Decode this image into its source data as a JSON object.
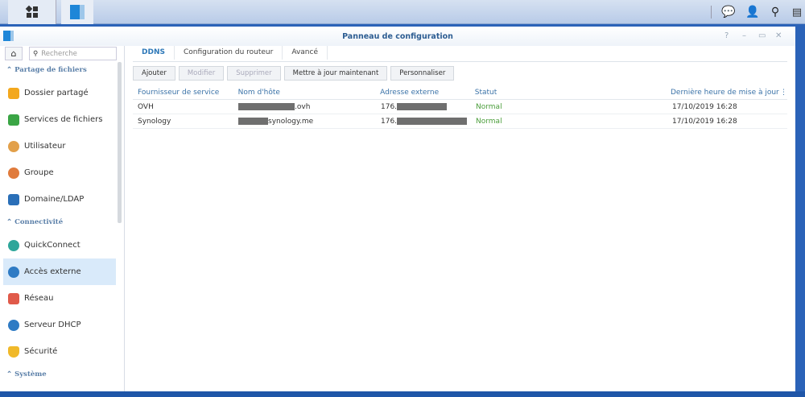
{
  "taskbar": {
    "icons": [
      "main-menu-icon",
      "control-panel-icon"
    ],
    "right_icons": [
      "chat-icon",
      "user-icon",
      "search-icon",
      "widgets-icon"
    ]
  },
  "window": {
    "title": "Panneau de configuration",
    "controls": [
      "?",
      "–",
      "▭",
      "✕"
    ]
  },
  "sidebar": {
    "search_placeholder": "Recherche",
    "sections": [
      {
        "label": "Partage de fichiers",
        "items": [
          {
            "label": "Dossier partagé",
            "icon": "folder-share-icon",
            "color": "#f3a81d"
          },
          {
            "label": "Services de fichiers",
            "icon": "file-services-icon",
            "color": "#3aa545"
          },
          {
            "label": "Utilisateur",
            "icon": "user-icon",
            "color": "#e2a04a"
          },
          {
            "label": "Groupe",
            "icon": "group-icon",
            "color": "#e07b3c"
          },
          {
            "label": "Domaine/LDAP",
            "icon": "domain-icon",
            "color": "#2a6fb8"
          }
        ]
      },
      {
        "label": "Connectivité",
        "items": [
          {
            "label": "QuickConnect",
            "icon": "quickconnect-icon",
            "color": "#2ea69a"
          },
          {
            "label": "Accès externe",
            "icon": "globe-icon",
            "color": "#2f7bc4",
            "selected": true
          },
          {
            "label": "Réseau",
            "icon": "network-icon",
            "color": "#e05a4a"
          },
          {
            "label": "Serveur DHCP",
            "icon": "dhcp-icon",
            "color": "#2f7bc4"
          },
          {
            "label": "Sécurité",
            "icon": "shield-icon",
            "color": "#f0b92a"
          }
        ]
      },
      {
        "label": "Système",
        "items": []
      }
    ]
  },
  "tabs": [
    {
      "label": "DDNS",
      "active": true
    },
    {
      "label": "Configuration du routeur"
    },
    {
      "label": "Avancé"
    }
  ],
  "toolbar": {
    "add": "Ajouter",
    "edit": "Modifier",
    "delete": "Supprimer",
    "update_now": "Mettre à jour maintenant",
    "customize": "Personnaliser"
  },
  "table": {
    "headers": [
      "Fournisseur de service",
      "Nom d'hôte",
      "Adresse externe",
      "Statut",
      "Dernière heure de mise à jour"
    ],
    "rows": [
      {
        "provider": "OVH",
        "hostname_suffix": ".ovh",
        "address_prefix": "176.",
        "status": "Normal",
        "updated": "17/10/2019 16:28"
      },
      {
        "provider": "Synology",
        "hostname_suffix": "synology.me",
        "address_prefix": "176.",
        "status": "Normal",
        "updated": "17/10/2019 16:28"
      }
    ]
  },
  "colors": {
    "accent": "#2d78b8",
    "status_normal": "#4a9d3a",
    "selected_bg": "#d9eafa"
  }
}
